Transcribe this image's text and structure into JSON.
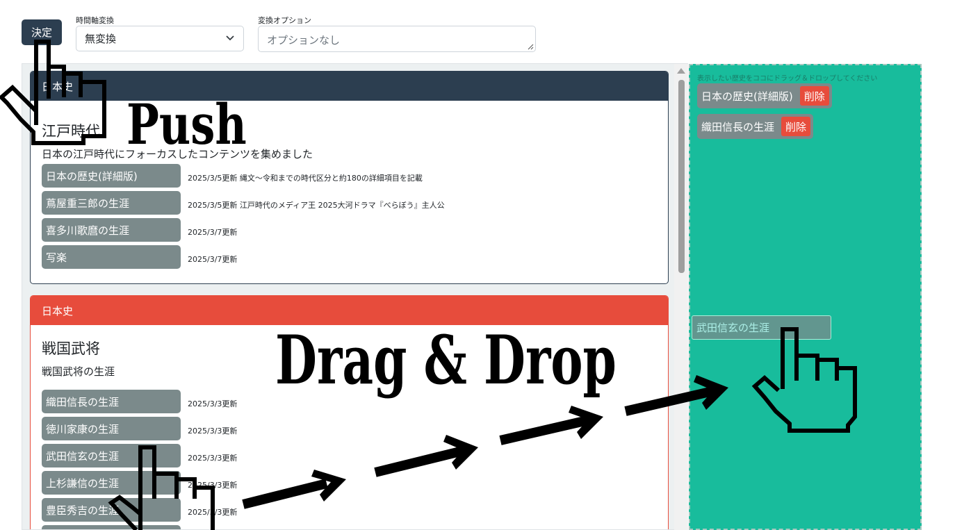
{
  "toolbar": {
    "decide_label": "決定",
    "time_axis_label": "時間軸変換",
    "time_axis_value": "無変換",
    "option_label": "変換オプション",
    "option_placeholder": "オプションなし"
  },
  "cards": [
    {
      "header": "日本史",
      "title": "江戸時代",
      "subtitle": "日本の江戸時代にフォーカスしたコンテンツを集めました",
      "items": [
        {
          "label": "日本の歴史(詳細版)",
          "note": "2025/3/5更新 縄文～令和までの時代区分と約180の詳細項目を記載"
        },
        {
          "label": "蔦屋重三郎の生涯",
          "note": "2025/3/5更新 江戸時代のメディア王 2025大河ドラマ『べらぼう』主人公"
        },
        {
          "label": "喜多川歌麿の生涯",
          "note": "2025/3/7更新"
        },
        {
          "label": "写楽",
          "note": "2025/3/7更新"
        }
      ]
    },
    {
      "header": "日本史",
      "title": "戦国武将",
      "subtitle": "戦国武将の生涯",
      "items": [
        {
          "label": "織田信長の生涯",
          "note": "2025/3/3更新"
        },
        {
          "label": "徳川家康の生涯",
          "note": "2025/3/3更新"
        },
        {
          "label": "武田信玄の生涯",
          "note": "2025/3/3更新"
        },
        {
          "label": "上杉謙信の生涯",
          "note": "2025/3/3更新"
        },
        {
          "label": "豊臣秀吉の生涯",
          "note": "2025/3/3更新"
        }
      ]
    }
  ],
  "dropzone": {
    "hint": "表示したい歴史をココにドラッグ＆ドロップしてください",
    "selected": [
      {
        "label": "日本の歴史(詳細版)",
        "delete": "削除"
      },
      {
        "label": "織田信長の生涯",
        "delete": "削除"
      }
    ],
    "dragging_label": "武田信玄の生涯"
  },
  "overlay": {
    "push_text": "Push",
    "dragdrop_text": "Drag & Drop"
  },
  "colors": {
    "primary": "#2c3e50",
    "danger": "#e74c3c",
    "success": "#18bc9c",
    "chip": "#7b8a8b"
  },
  "icons": [
    "chevron-down-icon",
    "pointer-hand-icon",
    "arrow-right-icon",
    "resize-grip-icon",
    "scroll-up-icon"
  ]
}
